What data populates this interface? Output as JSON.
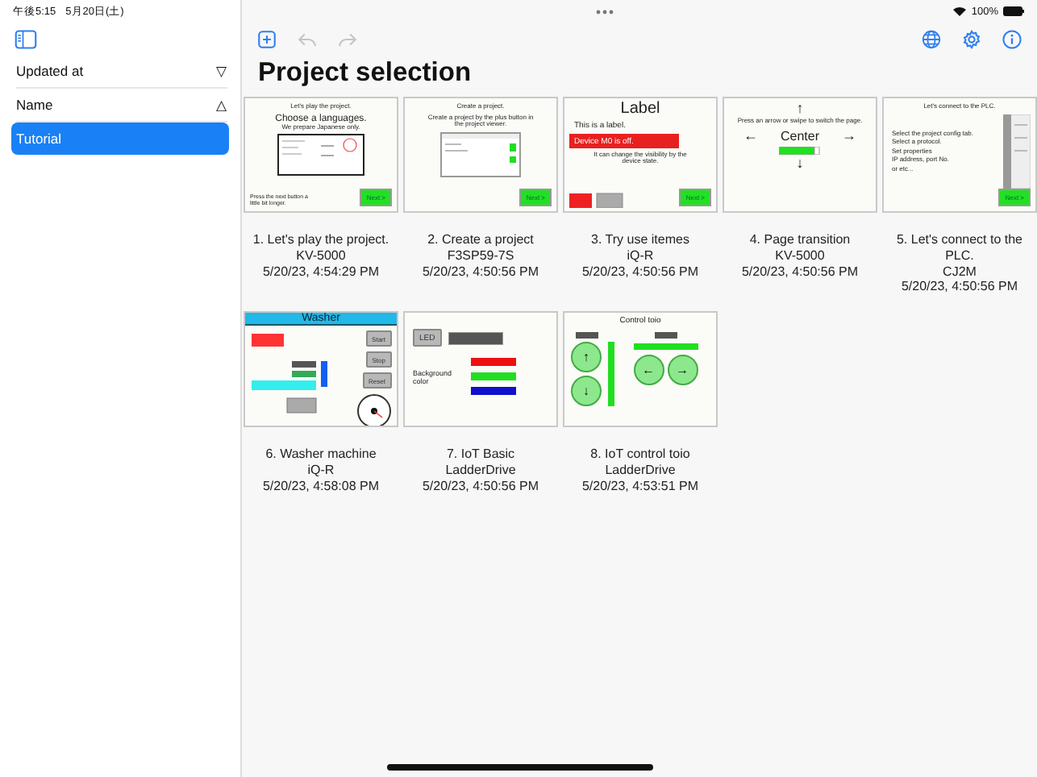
{
  "status_bar": {
    "time": "午後5:15",
    "date": "5月20日(土)",
    "battery": "100%"
  },
  "sidebar": {
    "sort_options": [
      {
        "label": "Updated at",
        "sort": "▽"
      },
      {
        "label": "Name",
        "sort": "△"
      }
    ],
    "folders": [
      {
        "label": "Tutorial",
        "selected": true
      }
    ]
  },
  "toolbar": {
    "left": [
      {
        "kind": "add",
        "disabled": false
      },
      {
        "kind": "undo",
        "disabled": true
      },
      {
        "kind": "redo",
        "disabled": true
      }
    ],
    "right": [
      {
        "kind": "globe"
      },
      {
        "kind": "settings"
      },
      {
        "kind": "info"
      }
    ]
  },
  "title": "Project selection",
  "projects": [
    {
      "name": "1. Let's play the project.",
      "device": "KV-5000",
      "updated": "5/20/23, 4:54:29 PM",
      "thumbnail": {
        "kind": "intro",
        "title": "Let's play the project.",
        "heading": "Choose a languages.",
        "subtitle": "We prepare Japanese only.",
        "note": "Press the next button a little bit longer.",
        "next": "Next >"
      }
    },
    {
      "name": "2. Create a project",
      "device": "F3SP59-7S",
      "updated": "5/20/23, 4:50:56 PM",
      "thumbnail": {
        "kind": "create",
        "title": "Create a project.",
        "subtitle": "Create a project by the plus button in the project viewer.",
        "next": "Next >"
      }
    },
    {
      "name": "3. Try use itemes",
      "device": "iQ-R",
      "updated": "5/20/23, 4:50:56 PM",
      "thumbnail": {
        "kind": "label",
        "title": "Label",
        "subtitle": "This is a label.",
        "alert": "Device M0 is off.",
        "note": "It can change the visibility by the device state.",
        "next": "Next >"
      }
    },
    {
      "name": "4. Page transition",
      "device": "KV-5000",
      "updated": "5/20/23, 4:50:56 PM",
      "thumbnail": {
        "kind": "transition",
        "note": "Press an arrow or swipe to switch the page.",
        "center": "Center",
        "up": "↑",
        "down": "↓",
        "left": "←",
        "right": "→"
      }
    },
    {
      "name": "5. Let's connect to the PLC.",
      "device": "CJ2M",
      "updated": "5/20/23, 4:50:56 PM",
      "thumbnail": {
        "kind": "connect",
        "title": "Let's connect to the PLC.",
        "lines": [
          "Select the project config tab.",
          "Select a protocol.",
          "Set properties",
          "IP address, port No.",
          "or etc..."
        ],
        "next": "Next >"
      }
    },
    {
      "name": "6. Washer machine",
      "device": "iQ-R",
      "updated": "5/20/23, 4:58:08 PM",
      "thumbnail": {
        "kind": "washer",
        "title": "Washer",
        "buttons": [
          "Start",
          "Stop",
          "Reset"
        ]
      }
    },
    {
      "name": "7. IoT Basic",
      "device": "LadderDrive",
      "updated": "5/20/23, 4:50:56 PM",
      "thumbnail": {
        "kind": "iot",
        "led": "LED",
        "label": "Background color"
      }
    },
    {
      "name": "8. IoT control toio",
      "device": "LadderDrive",
      "updated": "5/20/23, 4:53:51 PM",
      "thumbnail": {
        "kind": "toio",
        "title": "Control toio",
        "up": "↑",
        "down": "↓",
        "left": "←",
        "right": "→"
      }
    }
  ]
}
